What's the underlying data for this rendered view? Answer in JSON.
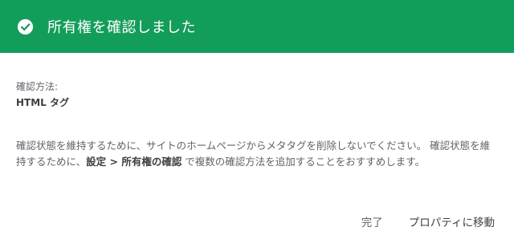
{
  "header": {
    "title": "所有権を確認しました",
    "icon": "check-circle-icon",
    "background_color": "#139d5a"
  },
  "method": {
    "label": "確認方法:",
    "value": "HTML タグ"
  },
  "description": {
    "text_before": "確認状態を維持するために、サイトのホームページからメタタグを削除しないでください。 確認状態を維持するために、",
    "setting_path": "設定 > 所有権の確認",
    "text_after": " で複数の確認方法を追加することをおすすめします。"
  },
  "actions": {
    "done_label": "完了",
    "go_to_property_label": "プロパティに移動"
  }
}
